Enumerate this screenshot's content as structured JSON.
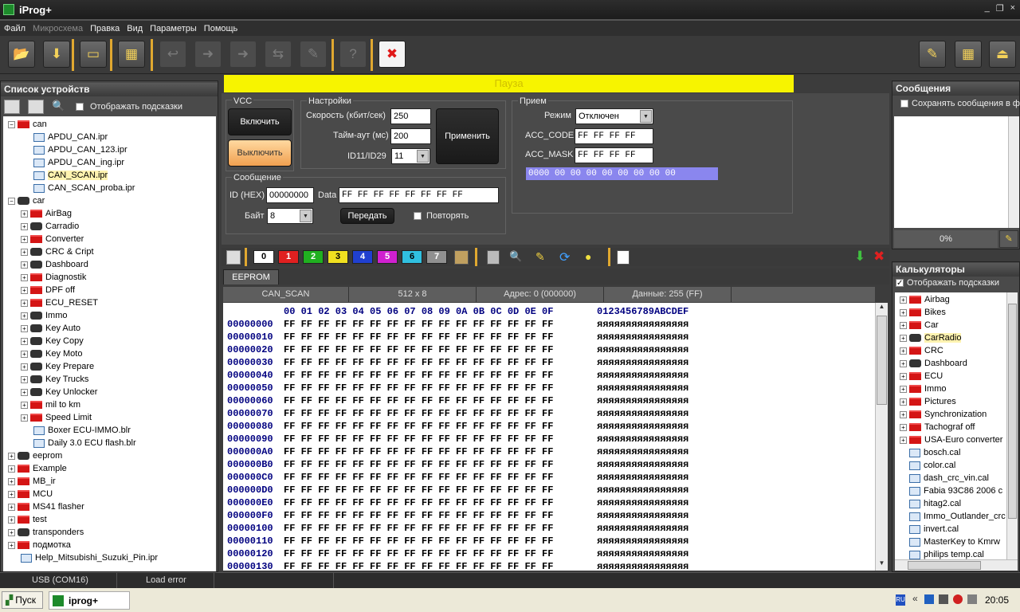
{
  "app": {
    "title": "iProg+"
  },
  "menu": [
    "Файл",
    "Микросхема",
    "Правка",
    "Вид",
    "Параметры",
    "Помощь"
  ],
  "menu_disabled": [
    false,
    true,
    false,
    false,
    false,
    false
  ],
  "toolbar": {
    "icons": [
      "open-folder-icon",
      "save-download-icon",
      "document-icon",
      "chip-icon",
      "back-icon",
      "red-arrow-icon",
      "yellow-arrow-icon",
      "compare-icon",
      "edit-icon",
      "help-icon",
      "close-icon"
    ],
    "right_icons": [
      "notepad-icon",
      "calculator-icon",
      "exit-icon"
    ]
  },
  "left_panel": {
    "title": "Список устройств",
    "show_hints": "Отображать подсказки",
    "tree": [
      {
        "label": "can",
        "kind": "folder",
        "level": 0,
        "exp": "−"
      },
      {
        "label": "APDU_CAN.ipr",
        "kind": "file",
        "level": 2
      },
      {
        "label": "APDU_CAN_123.ipr",
        "kind": "file",
        "level": 2
      },
      {
        "label": "APDU_CAN_ing.ipr",
        "kind": "file",
        "level": 2
      },
      {
        "label": "CAN_SCAN.ipr",
        "kind": "file",
        "level": 2,
        "selected": true
      },
      {
        "label": "CAN_SCAN_proba.ipr",
        "kind": "file",
        "level": 2
      },
      {
        "label": "car",
        "kind": "car",
        "level": 0,
        "exp": "−"
      },
      {
        "label": "AirBag",
        "kind": "folder",
        "level": 1,
        "exp": "+"
      },
      {
        "label": "Carradio",
        "kind": "car",
        "level": 1,
        "exp": "+"
      },
      {
        "label": "Converter",
        "kind": "folder",
        "level": 1,
        "exp": "+"
      },
      {
        "label": "CRC & Cript",
        "kind": "car",
        "level": 1,
        "exp": "+"
      },
      {
        "label": "Dashboard",
        "kind": "car",
        "level": 1,
        "exp": "+"
      },
      {
        "label": "Diagnostik",
        "kind": "folder",
        "level": 1,
        "exp": "+"
      },
      {
        "label": "DPF off",
        "kind": "folder",
        "level": 1,
        "exp": "+"
      },
      {
        "label": "ECU_RESET",
        "kind": "folder",
        "level": 1,
        "exp": "+"
      },
      {
        "label": "Immo",
        "kind": "car",
        "level": 1,
        "exp": "+"
      },
      {
        "label": "Key Auto",
        "kind": "car",
        "level": 1,
        "exp": "+"
      },
      {
        "label": "Key Copy",
        "kind": "car",
        "level": 1,
        "exp": "+"
      },
      {
        "label": "Key Moto",
        "kind": "car",
        "level": 1,
        "exp": "+"
      },
      {
        "label": "Key Prepare",
        "kind": "car",
        "level": 1,
        "exp": "+"
      },
      {
        "label": "Key Trucks",
        "kind": "car",
        "level": 1,
        "exp": "+"
      },
      {
        "label": "Key Unlocker",
        "kind": "car",
        "level": 1,
        "exp": "+"
      },
      {
        "label": "mil to km",
        "kind": "folder",
        "level": 1,
        "exp": "+"
      },
      {
        "label": "Speed Limit",
        "kind": "folder",
        "level": 1,
        "exp": "+"
      },
      {
        "label": "Boxer ECU-IMMO.blr",
        "kind": "file",
        "level": 2
      },
      {
        "label": "Daily 3.0 ECU flash.blr",
        "kind": "file",
        "level": 2
      },
      {
        "label": "eeprom",
        "kind": "car",
        "level": 0,
        "exp": "+"
      },
      {
        "label": "Example",
        "kind": "folder",
        "level": 0,
        "exp": "+"
      },
      {
        "label": "MB_ir",
        "kind": "folder",
        "level": 0,
        "exp": "+"
      },
      {
        "label": "MCU",
        "kind": "folder",
        "level": 0,
        "exp": "+"
      },
      {
        "label": "MS41 flasher",
        "kind": "folder",
        "level": 0,
        "exp": "+"
      },
      {
        "label": "test",
        "kind": "folder",
        "level": 0,
        "exp": "+"
      },
      {
        "label": "transponders",
        "kind": "car",
        "level": 0,
        "exp": "+"
      },
      {
        "label": "подмотка",
        "kind": "folder",
        "level": 0,
        "exp": "+"
      },
      {
        "label": "Help_Mitsubishi_Suzuki_Pin.ipr",
        "kind": "file",
        "level": 1
      }
    ]
  },
  "banner": {
    "text": "Пауза"
  },
  "vcc": {
    "title": "VCC",
    "on": "Включить",
    "off": "Выключить"
  },
  "settings": {
    "title": "Настройки",
    "speed_label": "Скорость (кбит/сек)",
    "speed": "250",
    "timeout_label": "Тайм-аут (мс)",
    "timeout": "200",
    "id_label": "ID11/ID29",
    "id": "11",
    "apply": "Применить"
  },
  "receive": {
    "title": "Прием",
    "mode_label": "Режим",
    "mode": "Отключен",
    "acc_code_label": "ACC_CODE",
    "acc_code": "FF FF FF FF",
    "acc_mask_label": "ACC_MASK",
    "acc_mask": "FF FF FF FF",
    "rx_line": "0000 00 00 00 00 00 00 00 00"
  },
  "message": {
    "title": "Сообщение",
    "id_label": "ID (HEX)",
    "id": "00000000",
    "data_label": "Data",
    "data": "FF FF FF FF FF FF FF FF",
    "byte_label": "Байт",
    "byte": "8",
    "send": "Передать",
    "repeat": "Повторять"
  },
  "color_buttons": [
    {
      "label": "0",
      "bg": "#ffffff",
      "fg": "#000000"
    },
    {
      "label": "1",
      "bg": "#e02020",
      "fg": "#ffffff"
    },
    {
      "label": "2",
      "bg": "#20b020",
      "fg": "#ffffff"
    },
    {
      "label": "3",
      "bg": "#f0e020",
      "fg": "#000000"
    },
    {
      "label": "4",
      "bg": "#2040d0",
      "fg": "#ffffff"
    },
    {
      "label": "5",
      "bg": "#d020d0",
      "fg": "#ffffff"
    },
    {
      "label": "6",
      "bg": "#30c0e0",
      "fg": "#000000"
    },
    {
      "label": "7",
      "bg": "#909090",
      "fg": "#ffffff"
    }
  ],
  "buffer": {
    "tab": "EEPROM",
    "name": "CAN_SCAN",
    "size": "512 x 8",
    "address": "Адрес: 0 (000000)",
    "data": "Данные: 255 (FF)",
    "col_header": "00 01 02 03 04 05 06 07 08 09 0A 0B 0C 0D 0E 0F",
    "ascii_header": "0123456789ABCDEF",
    "rows": [
      {
        "addr": "00000000"
      },
      {
        "addr": "00000010"
      },
      {
        "addr": "00000020"
      },
      {
        "addr": "00000030"
      },
      {
        "addr": "00000040"
      },
      {
        "addr": "00000050"
      },
      {
        "addr": "00000060"
      },
      {
        "addr": "00000070"
      },
      {
        "addr": "00000080"
      },
      {
        "addr": "00000090"
      },
      {
        "addr": "000000A0"
      },
      {
        "addr": "000000B0"
      },
      {
        "addr": "000000C0"
      },
      {
        "addr": "000000D0"
      },
      {
        "addr": "000000E0"
      },
      {
        "addr": "000000F0"
      },
      {
        "addr": "00000100"
      },
      {
        "addr": "00000110"
      },
      {
        "addr": "00000120"
      },
      {
        "addr": "00000130"
      }
    ],
    "byte_value": "FF",
    "ascii_value": "яяяяяяяяяяяяяяяя"
  },
  "messages_panel": {
    "title": "Сообщения",
    "save": "Сохранять сообщения в ф",
    "progress": "0%"
  },
  "calc_panel": {
    "title": "Калькуляторы",
    "show_hints": "Отображать подсказки",
    "tree": [
      {
        "label": "Airbag",
        "kind": "folder"
      },
      {
        "label": "Bikes",
        "kind": "folder"
      },
      {
        "label": "Car",
        "kind": "folder"
      },
      {
        "label": "CarRadio",
        "kind": "car",
        "selected": true
      },
      {
        "label": "CRC",
        "kind": "folder"
      },
      {
        "label": "Dashboard",
        "kind": "car"
      },
      {
        "label": "ECU",
        "kind": "folder"
      },
      {
        "label": "Immo",
        "kind": "folder"
      },
      {
        "label": "Pictures",
        "kind": "folder"
      },
      {
        "label": "Synchronization",
        "kind": "folder"
      },
      {
        "label": "Tachograf off",
        "kind": "folder"
      },
      {
        "label": "USA-Euro converter",
        "kind": "folder"
      },
      {
        "label": "bosch.cal",
        "kind": "file"
      },
      {
        "label": "color.cal",
        "kind": "file"
      },
      {
        "label": "dash_crc_vin.cal",
        "kind": "file"
      },
      {
        "label": "Fabia 93C86 2006 c",
        "kind": "file"
      },
      {
        "label": "hitag2.cal",
        "kind": "file"
      },
      {
        "label": "Immo_Outlander_crc",
        "kind": "file"
      },
      {
        "label": "invert.cal",
        "kind": "file"
      },
      {
        "label": "MasterKey to Kmrw",
        "kind": "file"
      },
      {
        "label": "philips temp.cal",
        "kind": "file"
      }
    ]
  },
  "status": {
    "port": "USB (COM16)",
    "load": "Load error"
  },
  "taskbar": {
    "start": "Пуск",
    "app": "iprog+",
    "lang": "RU",
    "time": "20:05"
  }
}
